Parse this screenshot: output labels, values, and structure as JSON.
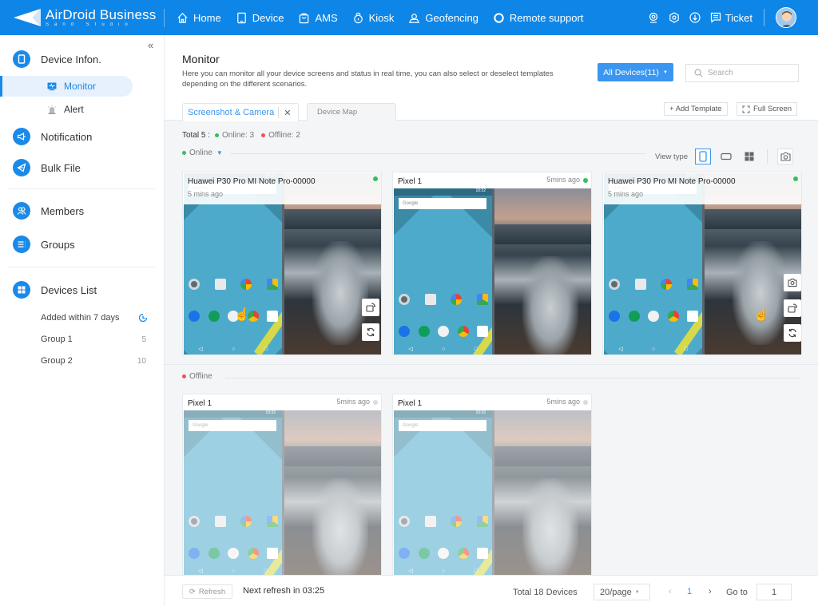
{
  "app": {
    "brand": "AirDroid Business",
    "brand_sub": "Sand Studio"
  },
  "topnav": {
    "items": [
      {
        "label": "Home",
        "icon": "home-icon"
      },
      {
        "label": "Device",
        "icon": "tablet-icon"
      },
      {
        "label": "AMS",
        "icon": "bag-icon"
      },
      {
        "label": "Kiosk",
        "icon": "lock-icon"
      },
      {
        "label": "Geofencing",
        "icon": "map-pin-user-icon"
      },
      {
        "label": "Remote support",
        "icon": "lifebuoy-icon"
      }
    ],
    "ticket_label": "Ticket"
  },
  "sidebar": {
    "device_info": "Device Infon.",
    "monitor": "Monitor",
    "alert": "Alert",
    "notification": "Notification",
    "bulk_file": "Bulk File",
    "members": "Members",
    "groups": "Groups",
    "devices_list": "Devices List",
    "device_groups": [
      {
        "label": "Added within 7 days",
        "count": ""
      },
      {
        "label": "Group 1",
        "count": "5"
      },
      {
        "label": "Group 2",
        "count": "10"
      }
    ]
  },
  "header": {
    "title": "Monitor",
    "description": "Here you can monitor all your device screens and status in real time, you can also select or deselect templates depending on the different scenarios.",
    "all_devices": "All Devices(11)",
    "search_placeholder": "Search",
    "tabs": [
      {
        "label": "Screenshot & Camera",
        "active": true
      },
      {
        "label": "Device Map",
        "active": false
      }
    ],
    "add_template": "+ Add Template",
    "full_screen": "Full Screen"
  },
  "summary": {
    "total": "Total 5 :",
    "online": "Online: 3",
    "offline": "Offline: 2"
  },
  "colors": {
    "brand": "#0e86e8",
    "online": "#35c05a",
    "offline": "#f0505a",
    "accent": "#3a96f0"
  },
  "sections": {
    "online_label": "Online",
    "offline_label": "Offline",
    "view_type_label": "View type"
  },
  "online_devices": [
    {
      "name": "Huawei P30 Pro MI Note Pro-00000",
      "time": "5 mins ago"
    },
    {
      "name": "Pixel 1",
      "time": "5mins ago"
    },
    {
      "name": "Huawei P30 Pro MI Note Pro-00000",
      "time": "5 mins ago"
    }
  ],
  "offline_devices": [
    {
      "name": "Pixel 1",
      "time": "5mins ago"
    },
    {
      "name": "Pixel 1",
      "time": "5mins ago"
    }
  ],
  "phone_screen": {
    "search_text": "Google",
    "clock": "10:32",
    "apps": [
      "Settings",
      "Play Store",
      "Photos",
      "Drive"
    ]
  },
  "footer": {
    "refresh": "Refresh",
    "next_refresh": "Next refresh in 03:25",
    "total": "Total 18 Devices",
    "per_page": "20/page",
    "current_page": "1",
    "goto_label": "Go to",
    "goto_value": "1"
  }
}
